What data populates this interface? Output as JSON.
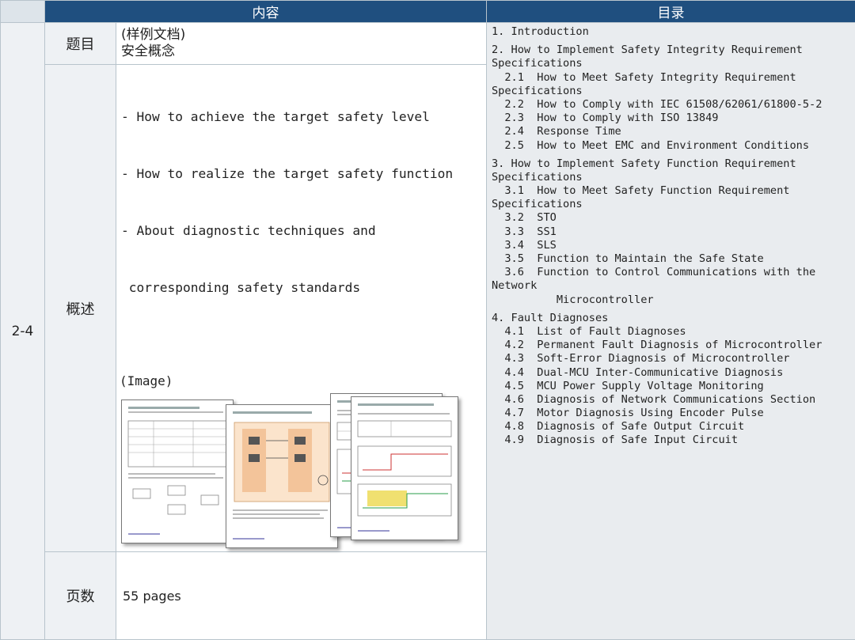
{
  "header": {
    "content": "内容",
    "toc": "目录"
  },
  "row_id": "2-4",
  "title": {
    "label": "题目",
    "lines": [
      "(样例文档)",
      "安全概念"
    ]
  },
  "summary": {
    "label": "概述",
    "lines": [
      "- How to achieve the target safety level",
      "- How to realize the target safety function",
      "- About diagnostic techniques and",
      " corresponding safety standards"
    ],
    "image_label": "(Image)"
  },
  "pages": {
    "label": "页数",
    "value": "55 pages"
  },
  "toc": {
    "lines": [
      "1. Introduction",
      "",
      "2. How to Implement Safety Integrity Requirement",
      "Specifications",
      "  2.1  How to Meet Safety Integrity Requirement",
      "Specifications",
      "  2.2  How to Comply with IEC 61508/62061/61800-5-2",
      "  2.3  How to Comply with ISO 13849",
      "  2.4  Response Time",
      "  2.5  How to Meet EMC and Environment Conditions",
      "",
      "3. How to Implement Safety Function Requirement",
      "Specifications",
      "  3.1  How to Meet Safety Function Requirement",
      "Specifications",
      "  3.2  STO",
      "  3.3  SS1",
      "  3.4  SLS",
      "  3.5  Function to Maintain the Safe State",
      "  3.6  Function to Control Communications with the",
      "Network",
      "          Microcontroller",
      "",
      "4. Fault Diagnoses",
      "  4.1  List of Fault Diagnoses",
      "  4.2  Permanent Fault Diagnosis of Microcontroller",
      "  4.3  Soft-Error Diagnosis of Microcontroller",
      "  4.4  Dual-MCU Inter-Communicative Diagnosis",
      "  4.5  MCU Power Supply Voltage Monitoring",
      "  4.6  Diagnosis of Network Communications Section",
      "  4.7  Motor Diagnosis Using Encoder Pulse",
      "  4.8  Diagnosis of Safe Output Circuit",
      "  4.9  Diagnosis of Safe Input Circuit"
    ]
  }
}
